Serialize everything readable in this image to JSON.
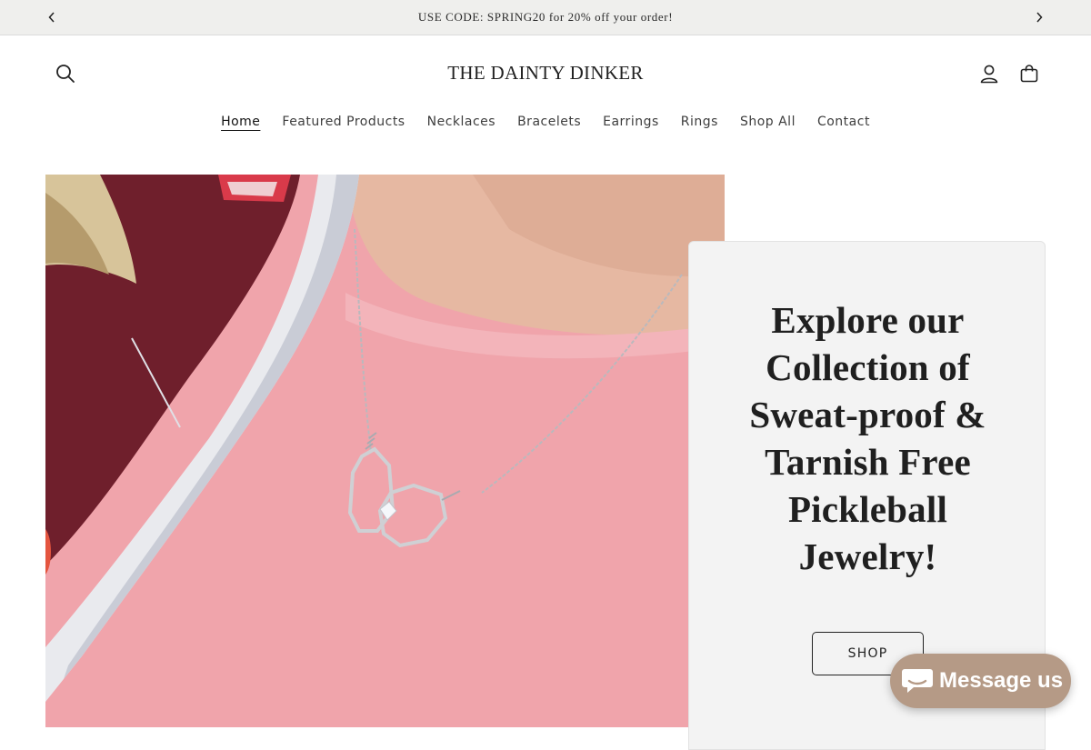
{
  "announcement": {
    "message": "USE CODE: SPRING20 for 20% off your order!",
    "prev_icon": "chevron-left-icon",
    "next_icon": "chevron-right-icon"
  },
  "header": {
    "logo": "THE DAINTY DINKER",
    "icons": [
      "search-icon",
      "account-icon",
      "cart-icon"
    ]
  },
  "nav": {
    "items": [
      {
        "label": "Home",
        "active": true
      },
      {
        "label": "Featured Products"
      },
      {
        "label": "Necklaces"
      },
      {
        "label": "Bracelets"
      },
      {
        "label": "Earrings"
      },
      {
        "label": "Rings"
      },
      {
        "label": "Shop All"
      },
      {
        "label": "Contact"
      }
    ]
  },
  "hero": {
    "heading": "Explore our Collection of Sweat-proof & Tarnish Free Pickleball Jewelry!",
    "button_label": "SHOP"
  },
  "chat": {
    "label": "Message us",
    "icon": "chat-bubble-icon"
  },
  "colors": {
    "announcement_bg": "#efefed",
    "card_bg": "#f3f3f3",
    "chat_bg": "#b59a86"
  }
}
